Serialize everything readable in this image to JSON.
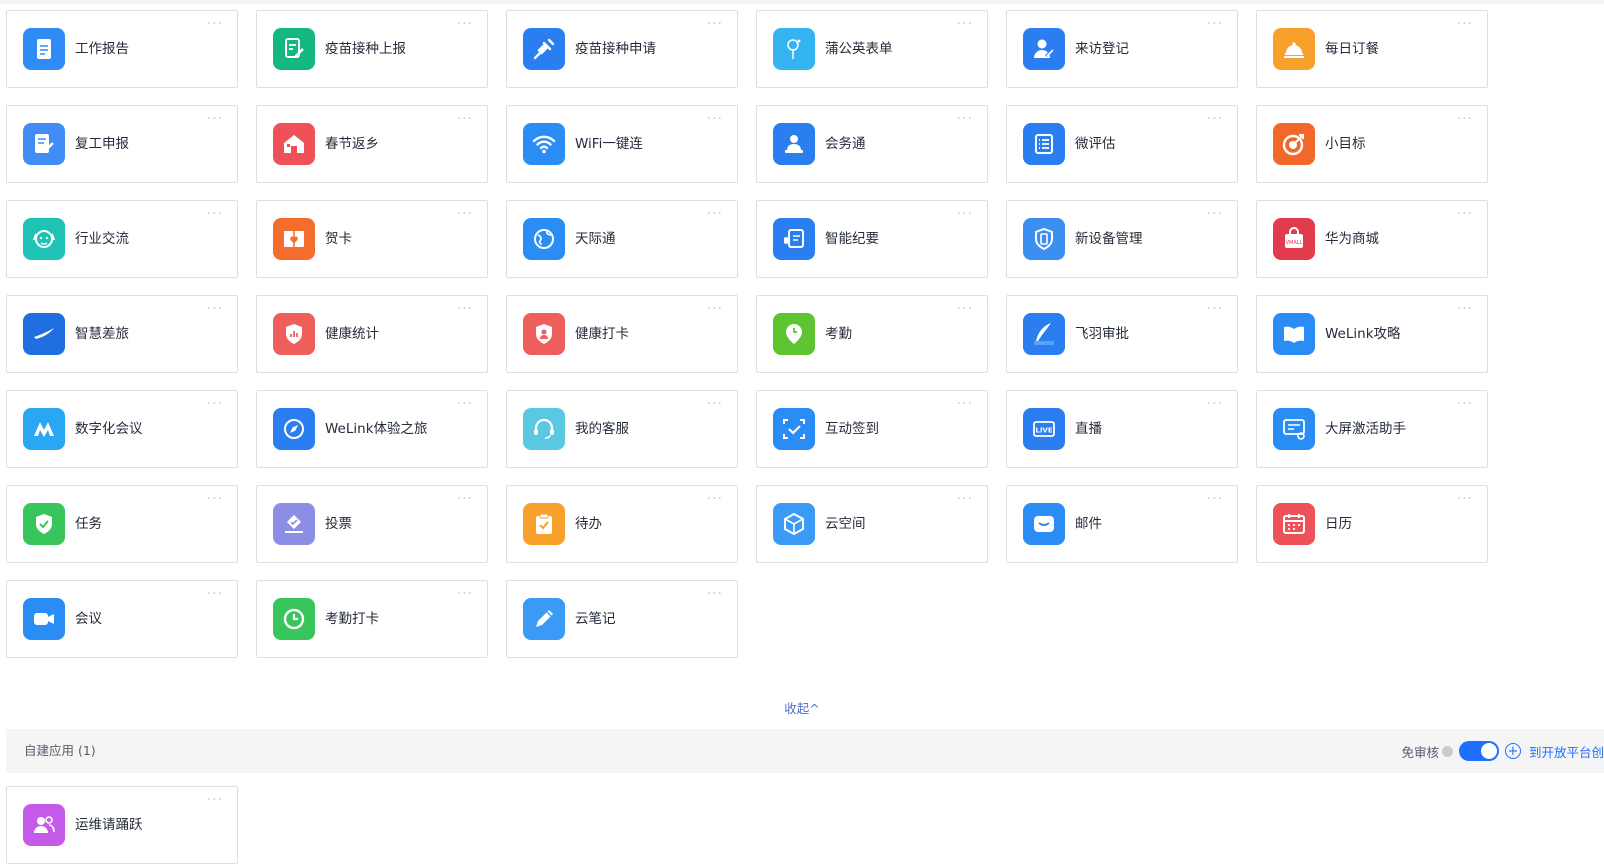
{
  "apps": [
    {
      "name": "工作报告",
      "icon": "report-document-icon",
      "color": "#2f8cf5"
    },
    {
      "name": "疫苗接种上报",
      "icon": "vaccine-report-icon",
      "color": "#14b87e"
    },
    {
      "name": "疫苗接种申请",
      "icon": "syringe-icon",
      "color": "#2a7ef0"
    },
    {
      "name": "蒲公英表单",
      "icon": "dandelion-icon",
      "color": "#34b5f2"
    },
    {
      "name": "来访登记",
      "icon": "visitor-icon",
      "color": "#2a7ef0"
    },
    {
      "name": "每日订餐",
      "icon": "meal-cloche-icon",
      "color": "#f7a12b"
    },
    {
      "name": "复工申报",
      "icon": "resume-work-icon",
      "color": "#3f8df5"
    },
    {
      "name": "春节返乡",
      "icon": "house-icon",
      "color": "#ee5258"
    },
    {
      "name": "WiFi一键连",
      "icon": "wifi-icon",
      "color": "#2a8cf5"
    },
    {
      "name": "会务通",
      "icon": "meeting-speaker-icon",
      "color": "#2a7ef0"
    },
    {
      "name": "微评估",
      "icon": "checklist-icon",
      "color": "#2a7ef0"
    },
    {
      "name": "小目标",
      "icon": "target-icon",
      "color": "#f2672a"
    },
    {
      "name": "行业交流",
      "icon": "dog-face-icon",
      "color": "#1fc3b5"
    },
    {
      "name": "贺卡",
      "icon": "greeting-card-icon",
      "color": "#f46d2c"
    },
    {
      "name": "天际通",
      "icon": "globe-icon",
      "color": "#2a8cf5"
    },
    {
      "name": "智能纪要",
      "icon": "voice-notes-icon",
      "color": "#2a7ef0"
    },
    {
      "name": "新设备管理",
      "icon": "shield-device-icon",
      "color": "#3a8ff0"
    },
    {
      "name": "华为商城",
      "icon": "vmall-bag-icon",
      "color": "#e23b4e"
    },
    {
      "name": "智慧差旅",
      "icon": "airplane-icon",
      "color": "#1f6fe0"
    },
    {
      "name": "健康统计",
      "icon": "health-stats-icon",
      "color": "#ee5f5b"
    },
    {
      "name": "健康打卡",
      "icon": "health-checkin-icon",
      "color": "#ee5f5b"
    },
    {
      "name": "考勤",
      "icon": "location-clock-icon",
      "color": "#5ec431"
    },
    {
      "name": "飞羽审批",
      "icon": "feather-approval-icon",
      "color": "#2a7ef0"
    },
    {
      "name": "WeLink攻略",
      "icon": "book-icon",
      "color": "#2a8cf5"
    },
    {
      "name": "数字化会议",
      "icon": "meeting-m-icon",
      "color": "#29a6f4"
    },
    {
      "name": "WeLink体验之旅",
      "icon": "compass-icon",
      "color": "#2a7ef0"
    },
    {
      "name": "我的客服",
      "icon": "headset-icon",
      "color": "#5ac8e0"
    },
    {
      "name": "互动签到",
      "icon": "scan-check-icon",
      "color": "#2a8cf5"
    },
    {
      "name": "直播",
      "icon": "live-icon",
      "color": "#2a7ef0"
    },
    {
      "name": "大屏激活助手",
      "icon": "screen-activate-icon",
      "color": "#2a8cf5"
    },
    {
      "name": "任务",
      "icon": "task-shield-icon",
      "color": "#37c55c"
    },
    {
      "name": "投票",
      "icon": "vote-icon",
      "color": "#8c8ee6"
    },
    {
      "name": "待办",
      "icon": "todo-clipboard-icon",
      "color": "#f7a12b"
    },
    {
      "name": "云空间",
      "icon": "cloud-space-cube-icon",
      "color": "#3a9af5"
    },
    {
      "name": "邮件",
      "icon": "mail-icon",
      "color": "#2a8cf5"
    },
    {
      "name": "日历",
      "icon": "calendar-icon",
      "color": "#ee5258"
    },
    {
      "name": "会议",
      "icon": "video-camera-icon",
      "color": "#2a8cf5"
    },
    {
      "name": "考勤打卡",
      "icon": "clock-checkin-icon",
      "color": "#37c55c"
    },
    {
      "name": "云笔记",
      "icon": "pencil-note-icon",
      "color": "#3a9af5"
    }
  ],
  "more_glyph": "···",
  "collapse_label": "收起",
  "collapse_arrow": "^",
  "custom_section": {
    "title": "自建应用 (1)",
    "review_label": "免审核",
    "review_toggle_on": true,
    "plus_glyph": "+",
    "open_platform_link": "到开放平台创"
  },
  "custom_apps": [
    {
      "name": "运维请踊跃",
      "icon": "group-users-icon",
      "color": "#c65ae8"
    }
  ],
  "colors": {
    "accent": "#1e6fff",
    "link": "#526ecc",
    "border": "#dcdfe6",
    "section_bg": "#f5f5f6"
  }
}
